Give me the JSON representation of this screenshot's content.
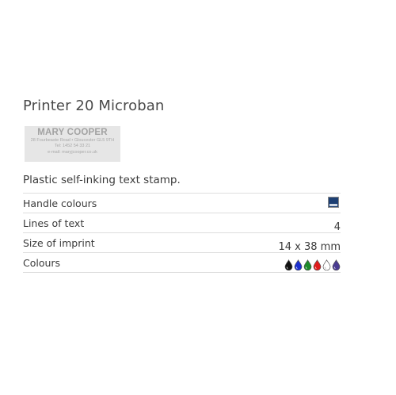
{
  "product": {
    "title": "Printer 20 Microban",
    "description": "Plastic self-inking text stamp."
  },
  "stamp_sample": {
    "name": "MARY COOPER",
    "lines": [
      "28 Fourbeaste Road  •  Gloucester GL5 9TH",
      "Tel: 1452 54 33 21",
      "e-mail: maryjcooper.co.uk"
    ]
  },
  "specs": [
    {
      "label": "Handle colours",
      "swatch_color": "#1d3f73"
    },
    {
      "label": "Lines of text",
      "value": "4"
    },
    {
      "label": "Size of imprint",
      "value": "14 x 38 mm"
    },
    {
      "label": "Colours",
      "ink_colors": [
        "#111111",
        "#1b2fd0",
        "#1d8a2a",
        "#e01b1b",
        "#ffffff",
        "#4a3c92"
      ]
    }
  ]
}
